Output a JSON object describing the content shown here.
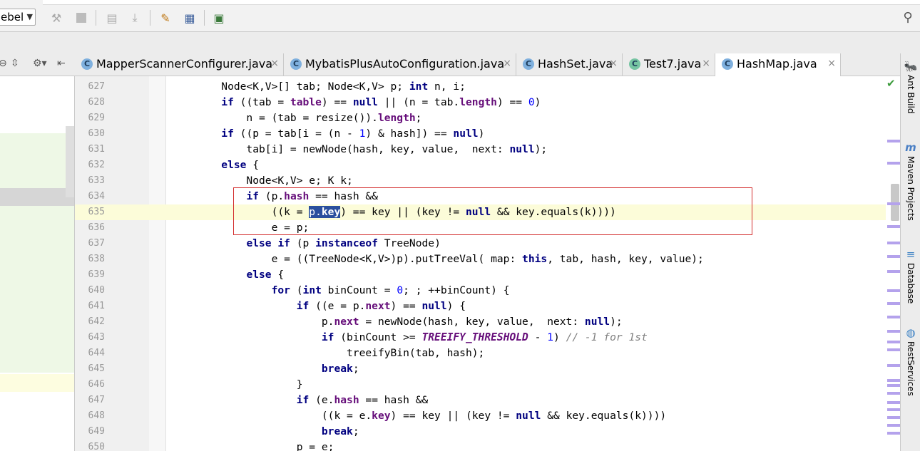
{
  "toolbar": {
    "config_select": "ebel",
    "icons": [
      "hammer-icon",
      "stop-icon",
      "build-icon",
      "download-icon",
      "wrench-icon",
      "structure-icon",
      "save-icon",
      "search-icon"
    ]
  },
  "tabs": [
    {
      "label": "MapperScannerConfigurer.java",
      "icon": "C",
      "active": false
    },
    {
      "label": "MybatisPlusAutoConfiguration.java",
      "icon": "C",
      "active": false
    },
    {
      "label": "HashSet.java",
      "icon": "C",
      "active": false
    },
    {
      "label": "Test7.java",
      "icon": "C",
      "active": false
    },
    {
      "label": "HashMap.java",
      "icon": "C",
      "active": true
    }
  ],
  "tab_close_glyph": "×",
  "right_tools": [
    {
      "label": "Ant Build",
      "icon": "ant-icon"
    },
    {
      "label": "Maven Projects",
      "icon": "maven-icon"
    },
    {
      "label": "Database",
      "icon": "database-icon"
    },
    {
      "label": "RestServices",
      "icon": "globe-icon"
    }
  ],
  "editor": {
    "current_line": 635,
    "lines": [
      {
        "n": 627,
        "t": "        Node<K,V>[] tab; Node<K,V> p; int n, i;"
      },
      {
        "n": 628,
        "t": "        if ((tab = table) == null || (n = tab.length) == 0)"
      },
      {
        "n": 629,
        "t": "            n = (tab = resize()).length;"
      },
      {
        "n": 630,
        "t": "        if ((p = tab[i = (n - 1) & hash]) == null)"
      },
      {
        "n": 631,
        "t": "            tab[i] = newNode(hash, key, value,  next: null);"
      },
      {
        "n": 632,
        "t": "        else {"
      },
      {
        "n": 633,
        "t": "            Node<K,V> e; K k;"
      },
      {
        "n": 634,
        "t": "            if (p.hash == hash &&"
      },
      {
        "n": 635,
        "t": "                ((k = p.key) == key || (key != null && key.equals(k))))"
      },
      {
        "n": 636,
        "t": "                e = p;"
      },
      {
        "n": 637,
        "t": "            else if (p instanceof TreeNode)"
      },
      {
        "n": 638,
        "t": "                e = ((TreeNode<K,V>)p).putTreeVal( map: this, tab, hash, key, value);"
      },
      {
        "n": 639,
        "t": "            else {"
      },
      {
        "n": 640,
        "t": "                for (int binCount = 0; ; ++binCount) {"
      },
      {
        "n": 641,
        "t": "                    if ((e = p.next) == null) {"
      },
      {
        "n": 642,
        "t": "                        p.next = newNode(hash, key, value,  next: null);"
      },
      {
        "n": 643,
        "t": "                        if (binCount >= TREEIFY_THRESHOLD - 1) // -1 for 1st"
      },
      {
        "n": 644,
        "t": "                            treeifyBin(tab, hash);"
      },
      {
        "n": 645,
        "t": "                        break;"
      },
      {
        "n": 646,
        "t": "                    }"
      },
      {
        "n": 647,
        "t": "                    if (e.hash == hash &&"
      },
      {
        "n": 648,
        "t": "                        ((k = e.key) == key || (key != null && key.equals(k))))"
      },
      {
        "n": 649,
        "t": "                        break;"
      },
      {
        "n": 650,
        "t": "                    p = e;"
      }
    ]
  },
  "colors": {
    "keyword": "#000080",
    "field": "#660e7a",
    "number": "#0000ff",
    "selection": "#2a4f9e",
    "highlight_box": "#d32f2f",
    "current_line": "#fcfcd9"
  }
}
